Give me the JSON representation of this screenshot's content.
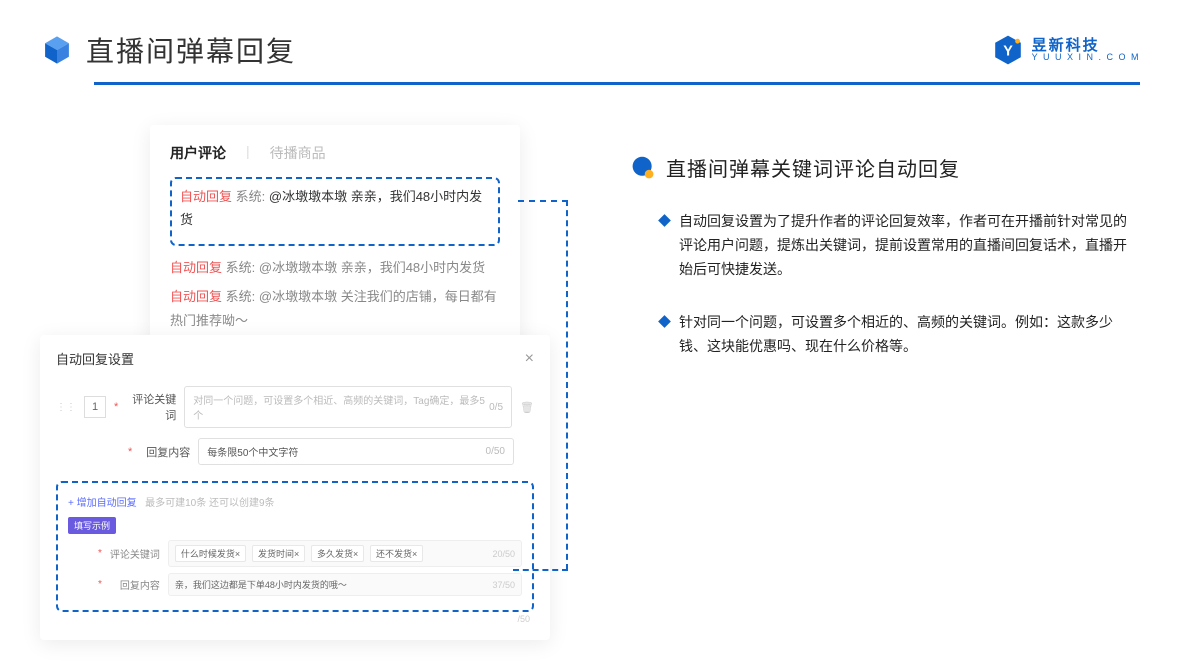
{
  "header": {
    "title": "直播间弹幕回复",
    "brand_cn": "昱新科技",
    "brand_en": "Y U U X I N . C O M"
  },
  "comments_card": {
    "tab_active": "用户评论",
    "tab_inactive": "待播商品",
    "hl_prefix": "自动回复",
    "hl_system": "系统:",
    "hl_text": "@冰墩墩本墩 亲亲，我们48小时内发货",
    "line2_prefix": "自动回复",
    "line2_system": "系统:",
    "line2_text": "@冰墩墩本墩 亲亲，我们48小时内发货",
    "line3_prefix": "自动回复",
    "line3_system": "系统:",
    "line3_text": "@冰墩墩本墩 关注我们的店铺，每日都有热门推荐呦～"
  },
  "settings_card": {
    "title": "自动回复设置",
    "idx": "1",
    "kw_label": "评论关键词",
    "kw_placeholder": "对同一个问题，可设置多个相近、高频的关键词，Tag确定，最多5个",
    "kw_count": "0/5",
    "reply_label": "回复内容",
    "reply_placeholder": "每条限50个中文字符",
    "reply_count": "0/50",
    "add_link": "+ 增加自动回复",
    "add_hint": "最多可建10条 还可以创建9条",
    "example_badge": "填写示例",
    "ex_kw_label": "评论关键词",
    "ex_tag1": "什么时候发货×",
    "ex_tag2": "发货时间×",
    "ex_tag3": "多久发货×",
    "ex_tag4": "还不发货×",
    "ex_kw_count": "20/50",
    "ex_reply_label": "回复内容",
    "ex_reply_text": "亲，我们这边都是下单48小时内发货的哦～",
    "ex_reply_count": "37/50",
    "outer_count": "/50"
  },
  "right": {
    "section_title": "直播间弹幕关键词评论自动回复",
    "bullet1": "自动回复设置为了提升作者的评论回复效率，作者可在开播前针对常见的评论用户问题，提炼出关键词，提前设置常用的直播间回复话术，直播开始后可快捷发送。",
    "bullet2": "针对同一个问题，可设置多个相近的、高频的关键词。例如：这款多少钱、这块能优惠吗、现在什么价格等。"
  }
}
